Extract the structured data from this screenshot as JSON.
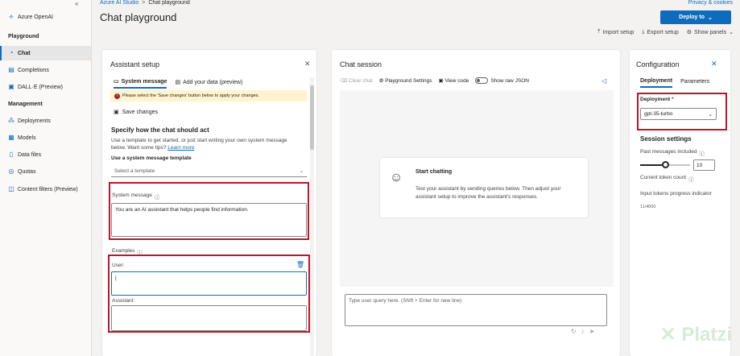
{
  "sidebar": {
    "collapse_icon": "«",
    "app_name": "Azure OpenAI",
    "sections": {
      "playground": "Playground",
      "management": "Management"
    },
    "items": [
      {
        "label": "Chat",
        "icon": "chat-icon"
      },
      {
        "label": "Completions",
        "icon": "completions-icon"
      },
      {
        "label": "DALL·E (Preview)",
        "icon": "image-icon"
      },
      {
        "label": "Deployments",
        "icon": "deployments-icon"
      },
      {
        "label": "Models",
        "icon": "models-icon"
      },
      {
        "label": "Data files",
        "icon": "file-icon"
      },
      {
        "label": "Quotas",
        "icon": "quota-icon"
      },
      {
        "label": "Content filters (Preview)",
        "icon": "shield-icon"
      }
    ]
  },
  "header": {
    "breadcrumb_root": "Azure AI Studio",
    "breadcrumb_sep": ">",
    "breadcrumb_current": "Chat playground",
    "title": "Chat playground",
    "privacy": "Privacy & cookies",
    "deploy_label": "Deploy to",
    "toolbar": {
      "import": "Import setup",
      "export": "Export setup",
      "panels": "Show panels"
    }
  },
  "assistant": {
    "title": "Assistant setup",
    "tab_system": "System message",
    "tab_data": "Add your data (preview)",
    "note": "Please select the 'Save changes' button below to apply your changes.",
    "save": "Save changes",
    "specify_heading": "Specify how the chat should act",
    "specify_desc_1": "Use a template to get started, or just start writing your own system message",
    "specify_desc_2": "below. Want some tips?",
    "learn_more": "Learn more",
    "template_label": "Use a system message template",
    "template_placeholder": "Select a template",
    "system_label": "System message",
    "system_value": "You are an AI assistant that helps people find information.",
    "examples_label": "Examples",
    "user_label": "User:",
    "assistant_label": "Assistant:"
  },
  "chat": {
    "title": "Chat session",
    "clear": "Clear chat",
    "settings": "Playground Settings",
    "view_code": "View code",
    "raw_json": "Show raw JSON",
    "start_title": "Start chatting",
    "start_desc_1": "Test your assistant by sending queries below. Then adjust your",
    "start_desc_2": "assistant setup to improve the assistant's responses.",
    "query_placeholder": "Type user query here. (Shift + Enter for new line)"
  },
  "config": {
    "title": "Configuration",
    "tab_deployment": "Deployment",
    "tab_parameters": "Parameters",
    "deployment_label": "Deployment",
    "required_mark": "*",
    "deployment_value": "gpt-35-turbo",
    "session_heading": "Session settings",
    "past_messages_label": "Past messages included",
    "past_messages_value": "10",
    "past_messages_fraction": 0.5,
    "token_count_label": "Current token count",
    "token_progress_label": "Input tokens progress indicator",
    "token_value": "11/4000"
  },
  "watermark": "Platzi",
  "colors": {
    "accent": "#0f6cbd",
    "highlight": "#c0142a",
    "note_bg": "#fff4ce"
  }
}
